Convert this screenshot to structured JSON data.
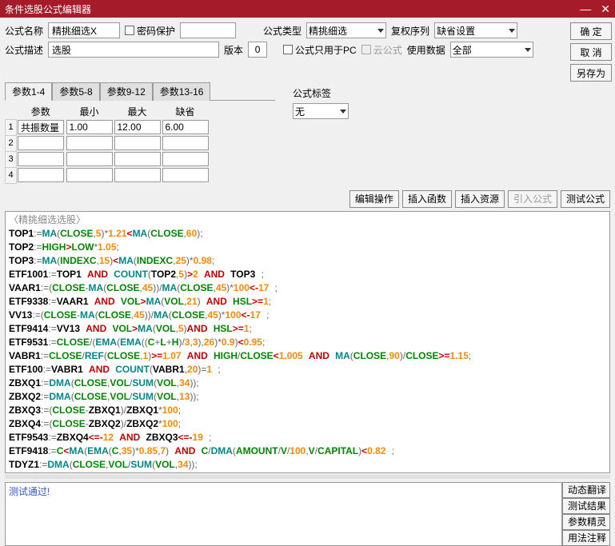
{
  "window": {
    "title": "条件选股公式编辑器"
  },
  "labels": {
    "name": "公式名称",
    "pwd": "密码保护",
    "desc": "公式描述",
    "ver": "版本",
    "type": "公式类型",
    "fqseq": "复权序列",
    "pconly": "公式只用于PC",
    "cloud": "云公式",
    "usedata": "使用数据",
    "tag": "公式标签"
  },
  "fields": {
    "name": "精挑细选X",
    "desc": "选股",
    "ver": "0",
    "type": "精挑细选",
    "fqseq": "缺省设置",
    "usedata": "全部",
    "tag": "无"
  },
  "param_tabs": [
    "参数1-4",
    "参数5-8",
    "参数9-12",
    "参数13-16"
  ],
  "param_headers": [
    "参数",
    "最小",
    "最大",
    "缺省"
  ],
  "params": [
    {
      "n": "1",
      "name": "共振数量",
      "min": "1.00",
      "max": "12.00",
      "def": "6.00"
    },
    {
      "n": "2",
      "name": "",
      "min": "",
      "max": "",
      "def": ""
    },
    {
      "n": "3",
      "name": "",
      "min": "",
      "max": "",
      "def": ""
    },
    {
      "n": "4",
      "name": "",
      "min": "",
      "max": "",
      "def": ""
    }
  ],
  "buttons": {
    "ok": "确 定",
    "cancel": "取 消",
    "saveas": "另存为",
    "editop": "编辑操作",
    "insfn": "插入函数",
    "insres": "插入资源",
    "incform": "引入公式",
    "test": "测试公式",
    "dyntrans": "动态翻译",
    "testres": "测试结果",
    "paramwiz": "参数精灵",
    "usage": "用法注释"
  },
  "code_title": "〈精挑细选选股〉",
  "status": "测试通过!"
}
